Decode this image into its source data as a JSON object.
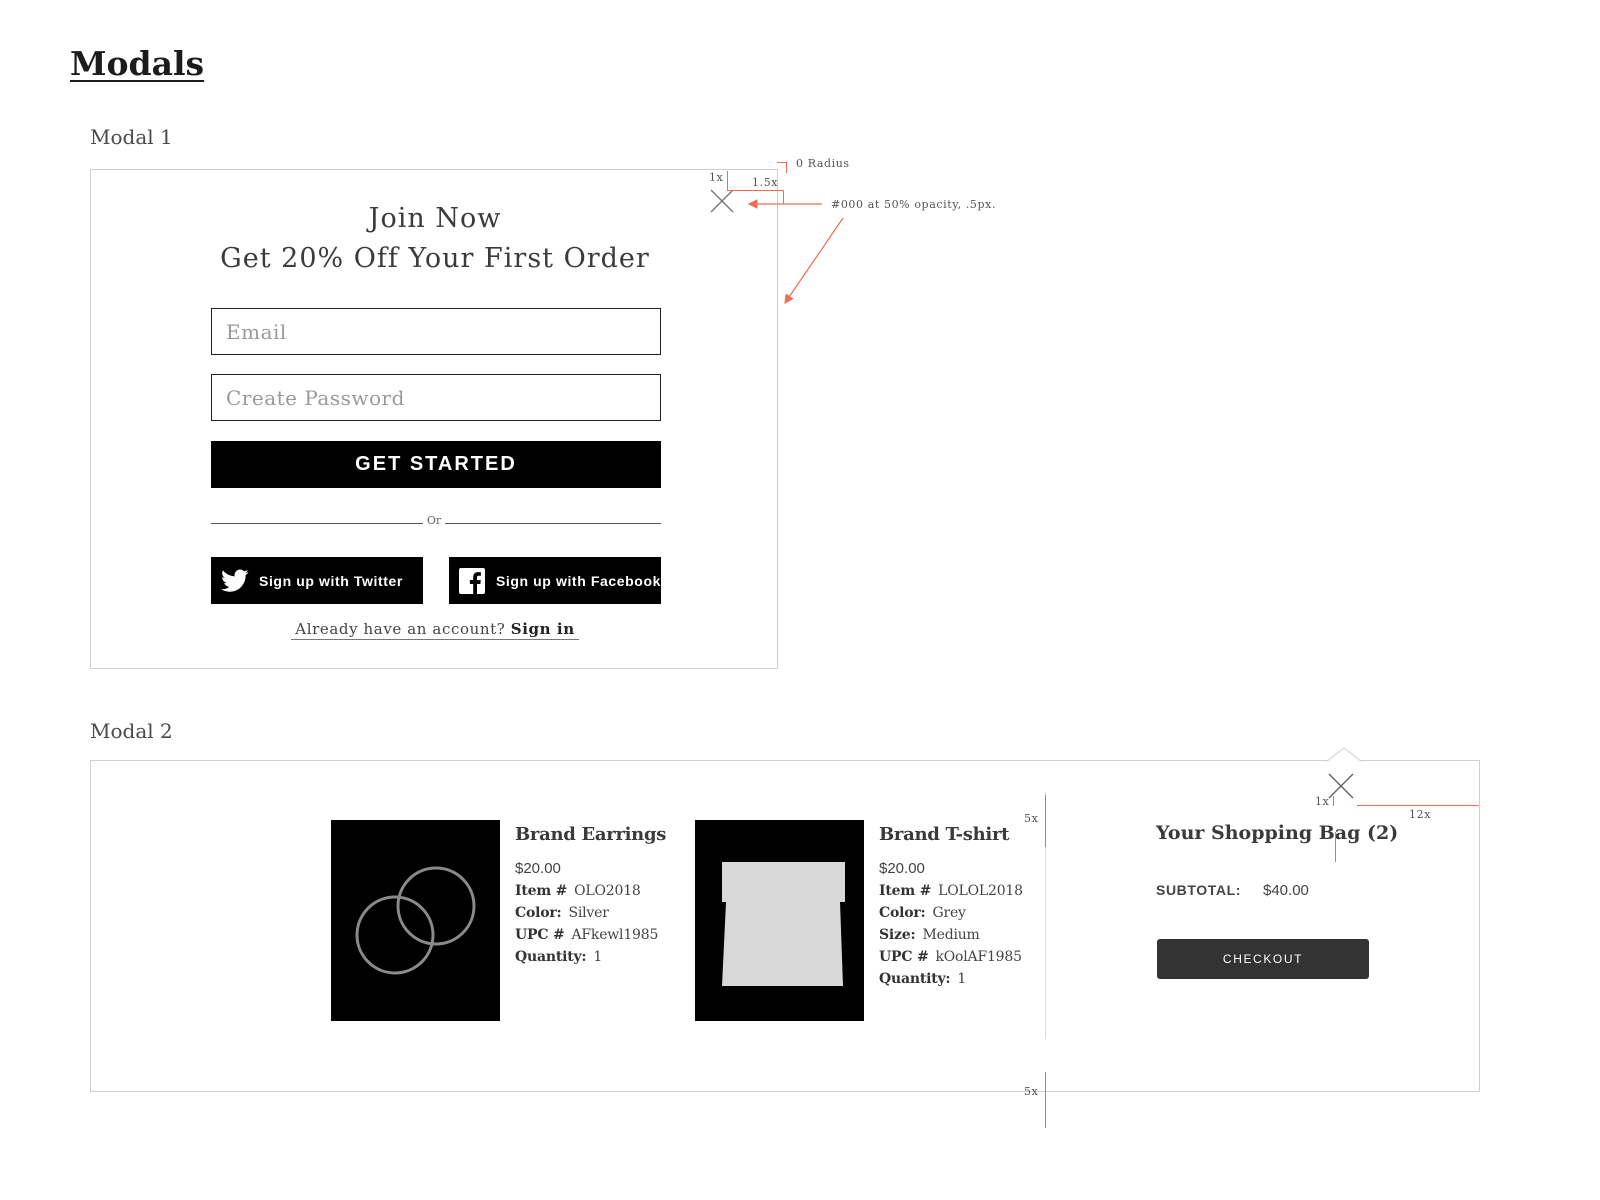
{
  "page": {
    "title": "Modals"
  },
  "modal1": {
    "section_label": "Modal 1",
    "title_line1": "Join Now",
    "title_line2": "Get 20% Off Your First Order",
    "email_placeholder": "Email",
    "password_placeholder": "Create Password",
    "cta_label": "GET STARTED",
    "divider_text": "Or",
    "twitter_label": "Sign up with Twitter",
    "facebook_label": "Sign up with Facebook",
    "account_prompt": "Already have an account?",
    "signin_label": "Sign in",
    "close_icon": "close-icon",
    "annotations": {
      "radius": "0 Radius",
      "close_offset_top": "1x",
      "close_offset_right": "1.5x",
      "border_spec": "#000 at 50% opacity, .5px."
    }
  },
  "modal2": {
    "section_label": "Modal 2",
    "close_icon": "close-icon",
    "products": [
      {
        "name": "Brand Earrings",
        "price": "$20.00",
        "details": [
          {
            "key": "Item #",
            "value": "OLO2018"
          },
          {
            "key": "Color:",
            "value": "Silver"
          },
          {
            "key": "UPC #",
            "value": "AFkewl1985"
          },
          {
            "key": "Quantity:",
            "value": "1"
          }
        ]
      },
      {
        "name": "Brand T-shirt",
        "price": "$20.00",
        "details": [
          {
            "key": "Item #",
            "value": "LOLOL2018"
          },
          {
            "key": "Color:",
            "value": "Grey"
          },
          {
            "key": "Size:",
            "value": "Medium"
          },
          {
            "key": "UPC #",
            "value": "kOolAF1985"
          },
          {
            "key": "Quantity:",
            "value": "1"
          }
        ]
      }
    ],
    "bag_title": "Your Shopping Bag (2)",
    "subtotal_label": "SUBTOTAL:",
    "subtotal_value": "$40.00",
    "checkout_label": "CHECKOUT",
    "annotations": {
      "divider_top": "5x",
      "divider_bottom": "5x",
      "close_left": "1x",
      "close_right": "12x"
    }
  },
  "colors": {
    "annotation": "#f06a55",
    "button_primary": "#000000",
    "button_checkout": "#333333",
    "modal_border": "#cfcfcf",
    "product_image_bg": "#000000"
  }
}
